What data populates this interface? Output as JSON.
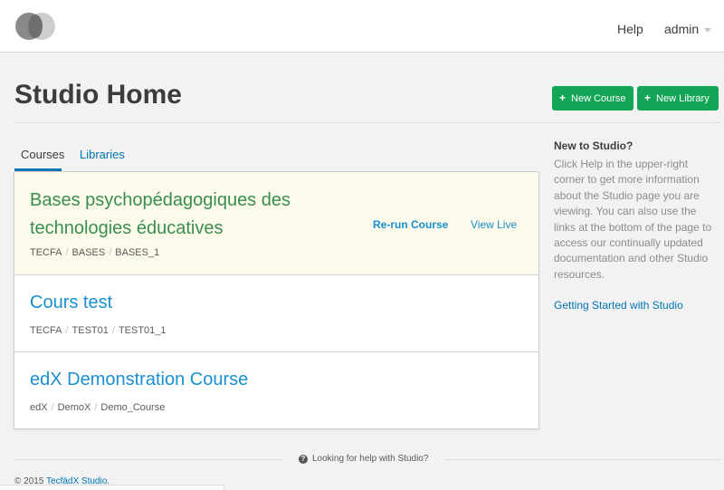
{
  "header": {
    "help_label": "Help",
    "user_label": "admin"
  },
  "page": {
    "title": "Studio Home",
    "new_course_label": "New Course",
    "new_library_label": "New Library",
    "accent_color": "#13a657"
  },
  "tabs": [
    {
      "label": "Courses",
      "active": true
    },
    {
      "label": "Libraries",
      "active": false
    }
  ],
  "courses": [
    {
      "name": "Bases psychopédagogiques des technologies éducatives",
      "org": "TECFA",
      "number": "BASES",
      "run": "BASES_1",
      "actions": [
        "Re-run Course",
        "View Live"
      ]
    },
    {
      "name": "Cours test",
      "org": "TECFA",
      "number": "TEST01",
      "run": "TEST01_1"
    },
    {
      "name": "edX Demonstration Course",
      "org": "edX",
      "number": "DemoX",
      "run": "Demo_Course"
    }
  ],
  "sidebar": {
    "title": "New to Studio?",
    "text": "Click Help in the upper-right corner to get more information about the Studio page you are viewing. You can also use the links at the bottom of the page to access our continually updated documentation and other Studio resources.",
    "link": "Getting Started with Studio"
  },
  "footer": {
    "help_text": "Looking for help with Studio?",
    "copyright_prefix": "© 2015",
    "copyright_link": "TecfädX Studio."
  }
}
